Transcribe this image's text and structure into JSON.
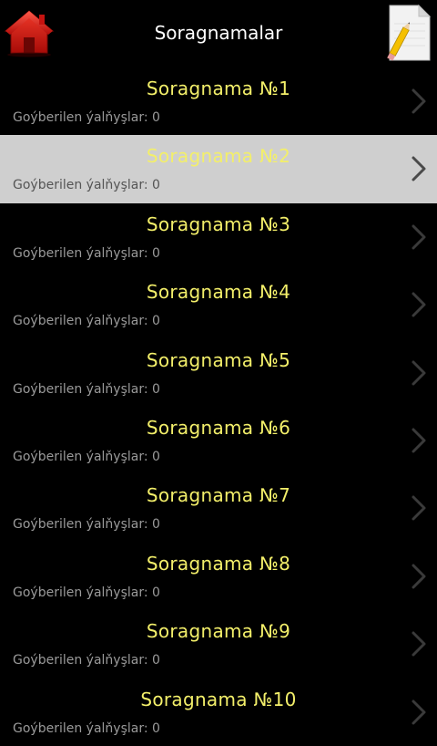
{
  "header": {
    "title": "Soragnamalar"
  },
  "list": {
    "subtitle_label": "Goýberilen ýalňyşlar: 0",
    "items": [
      {
        "title": "Soragnama №1",
        "subtitle": "Goýberilen ýalňyşlar: 0",
        "selected": false
      },
      {
        "title": "Soragnama №2",
        "subtitle": "Goýberilen ýalňyşlar: 0",
        "selected": true
      },
      {
        "title": "Soragnama №3",
        "subtitle": "Goýberilen ýalňyşlar: 0",
        "selected": false
      },
      {
        "title": "Soragnama №4",
        "subtitle": "Goýberilen ýalňyşlar: 0",
        "selected": false
      },
      {
        "title": "Soragnama №5",
        "subtitle": "Goýberilen ýalňyşlar: 0",
        "selected": false
      },
      {
        "title": "Soragnama №6",
        "subtitle": "Goýberilen ýalňyşlar: 0",
        "selected": false
      },
      {
        "title": "Soragnama №7",
        "subtitle": "Goýberilen ýalňyşlar: 0",
        "selected": false
      },
      {
        "title": "Soragnama №8",
        "subtitle": "Goýberilen ýalňyşlar: 0",
        "selected": false
      },
      {
        "title": "Soragnama №9",
        "subtitle": "Goýberilen ýalňyşlar: 0",
        "selected": false
      },
      {
        "title": "Soragnama №10",
        "subtitle": "Goýberilen ýalňyşlar: 0",
        "selected": false
      }
    ]
  },
  "icons": {
    "home": "home-icon",
    "document": "document-pencil-icon",
    "chevron": "chevron-right-icon"
  },
  "colors": {
    "background": "#000000",
    "title_text": "#ffffff",
    "item_title": "#f3ef6a",
    "item_subtitle": "#9a9a9a",
    "selected_row": "#cfcfcf",
    "home_icon": "#e0201a"
  }
}
